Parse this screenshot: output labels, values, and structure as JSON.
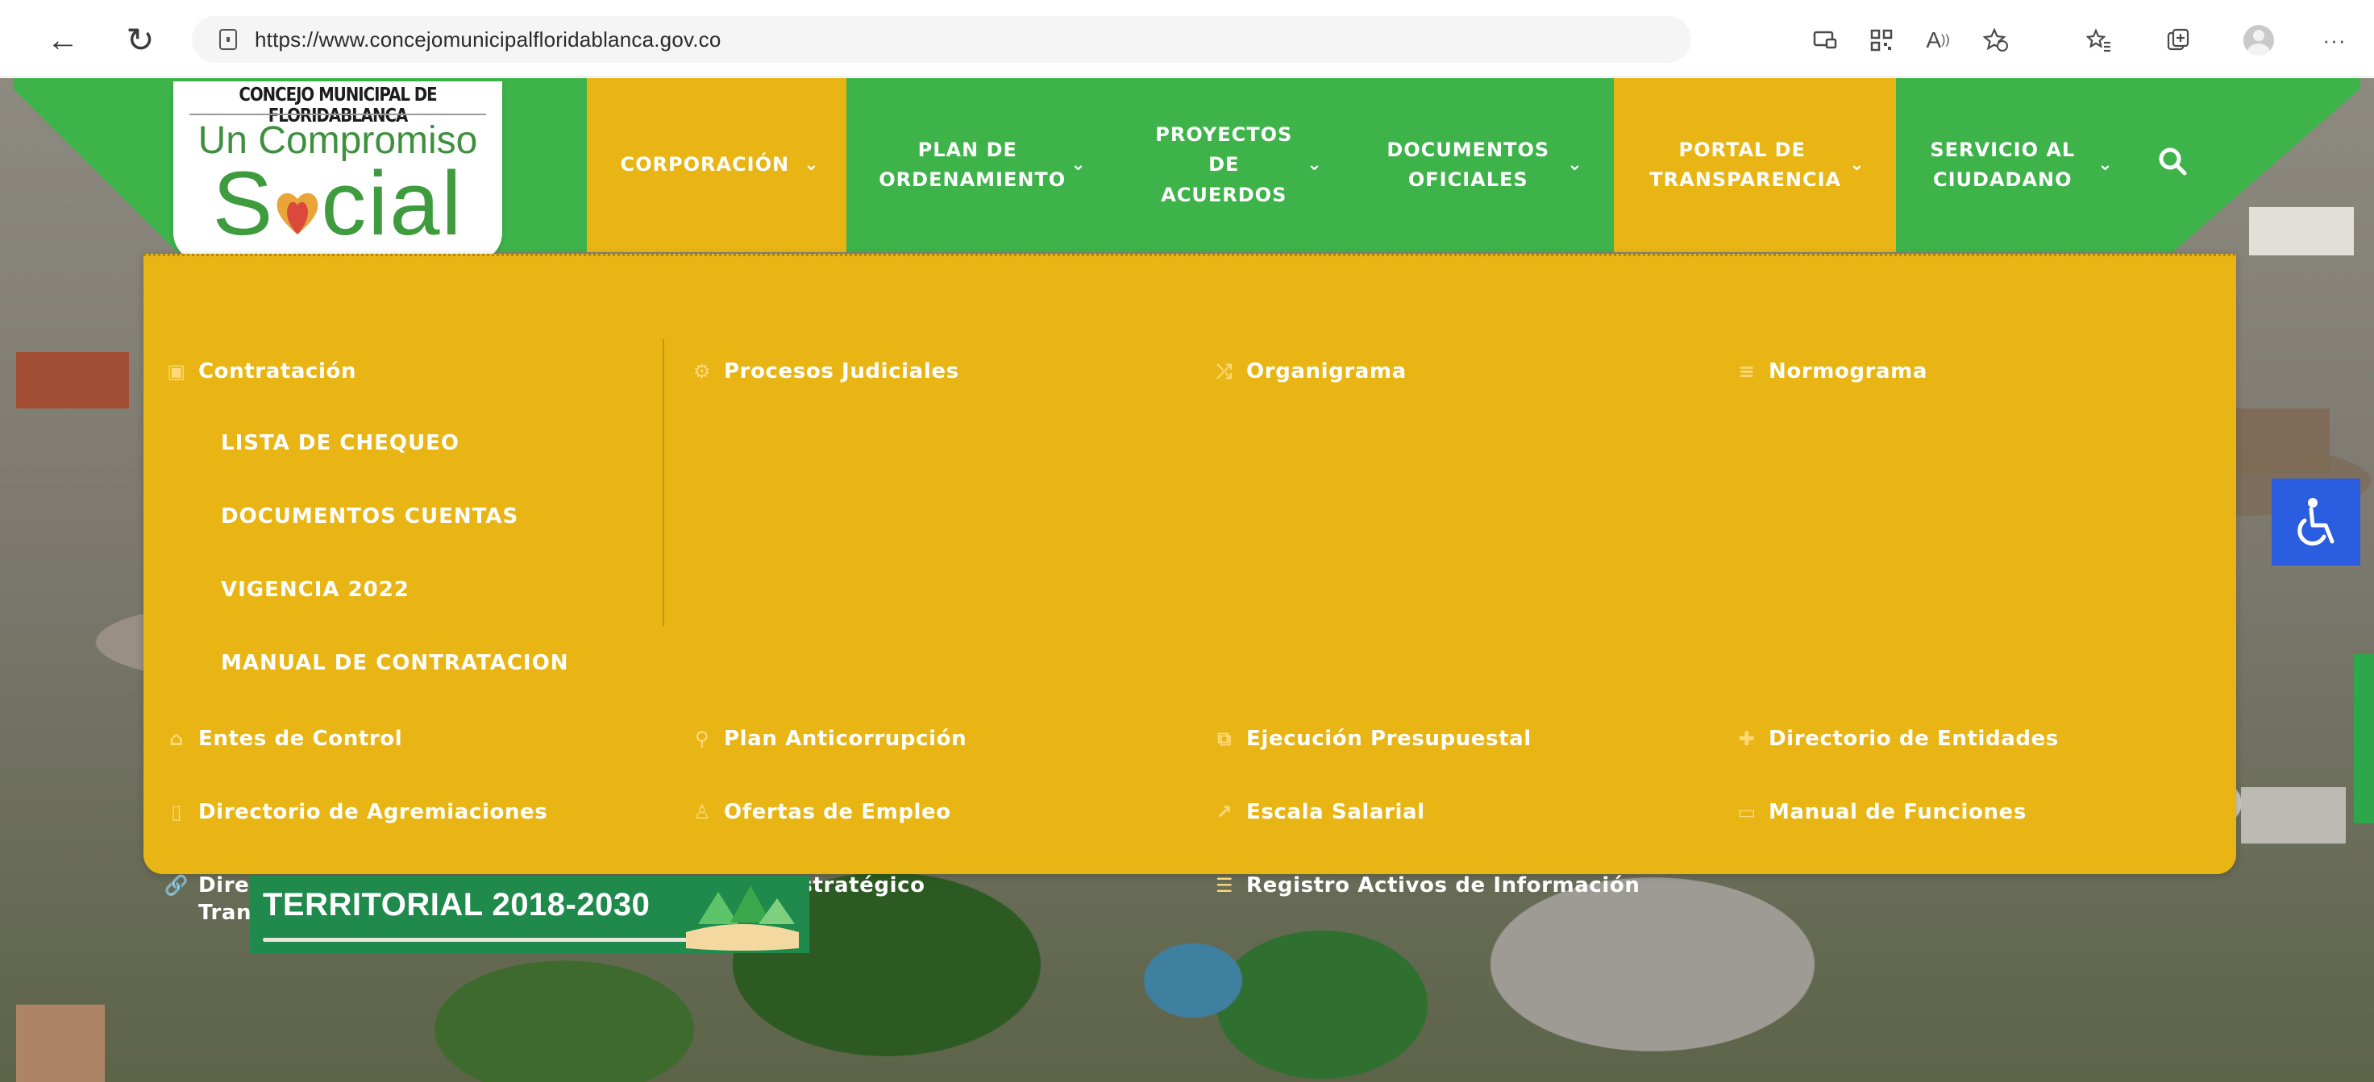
{
  "browser": {
    "url": "https://www.concejomunicipalfloridablanca.gov.co",
    "toolbar_icons": [
      "back-icon",
      "reload-icon",
      "lock-icon",
      "reader-view-icon",
      "qr-code-icon",
      "read-aloud-icon",
      "add-favorite-icon",
      "favorites-icon",
      "collections-icon",
      "profile-avatar",
      "more-menu-icon"
    ]
  },
  "logo": {
    "top_text": "CONCEJO MUNICIPAL DE FLORIDABLANCA",
    "line1": "Un Compromiso",
    "line2_pre": "S",
    "line2_post": "cial"
  },
  "nav": {
    "items": [
      {
        "label": "CORPORACIÓN",
        "active": true
      },
      {
        "label": "PLAN DE ORDENAMIENTO",
        "active": false
      },
      {
        "label": "PROYECTOS DE ACUERDOS",
        "active": false
      },
      {
        "label": "DOCUMENTOS OFICIALES",
        "active": false
      },
      {
        "label": "PORTAL DE TRANSPARENCIA",
        "active": true
      },
      {
        "label": "SERVICIO AL CIUDADANO",
        "active": false
      }
    ],
    "search_icon": "search-icon"
  },
  "menu": {
    "row1": [
      "Contratación",
      "Procesos Judiciales",
      "Organigrama",
      "Normograma"
    ],
    "sub_items": [
      "LISTA DE CHEQUEO",
      "DOCUMENTOS CUENTAS",
      "VIGENCIA 2022",
      "MANUAL DE CONTRATACION"
    ],
    "row2": [
      "Entes de Control",
      "Plan Anticorrupción",
      "Ejecución Presupuestal",
      "Directorio de Entidades"
    ],
    "row3": [
      "Directorio de Agremiaciones",
      "Ofertas de Empleo",
      "Escala Salarial",
      "Manual de Funciones"
    ],
    "row4": [
      "Directorio Portal de Transparencia",
      "Plan Estratégico",
      "Registro Activos de Información"
    ]
  },
  "banner": {
    "text": "TERRITORIAL 2018-2030"
  },
  "colors": {
    "green": "#3db34a",
    "yellow": "#e8b514",
    "accessibility_blue": "#2a5ddf"
  }
}
